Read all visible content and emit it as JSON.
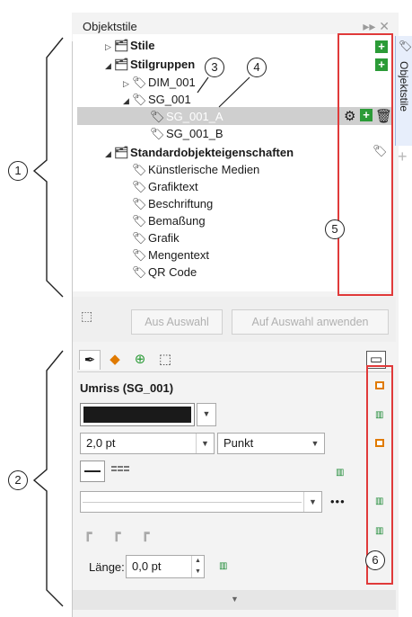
{
  "docker": {
    "title": "Objektstile",
    "controls": "▸▸ ✕",
    "side_tab_label": "Objektstile"
  },
  "tree": {
    "items": [
      {
        "label": "Stile",
        "icon": "styles-folder-icon",
        "bold": true,
        "expander": "▷"
      },
      {
        "label": "Stilgruppen",
        "icon": "style-groups-icon",
        "bold": true,
        "expander": "◢"
      },
      {
        "label": "DIM_001",
        "icon": "style-set-icon",
        "bold": false,
        "expander": "▷"
      },
      {
        "label": "SG_001",
        "icon": "style-set-icon",
        "bold": false,
        "expander": "◢"
      },
      {
        "label": "SG_001_A",
        "icon": "style-set-icon",
        "bold": false,
        "expander": "",
        "selected": true
      },
      {
        "label": "SG_001_B",
        "icon": "style-set-icon",
        "bold": false,
        "expander": ""
      },
      {
        "label": "Standardobjekteigenschaften",
        "icon": "default-properties-icon",
        "bold": true,
        "expander": "◢"
      },
      {
        "label": "Künstlerische Medien",
        "icon": "style-set-icon",
        "bold": false,
        "expander": ""
      },
      {
        "label": "Grafiktext",
        "icon": "style-set-icon",
        "bold": false,
        "expander": ""
      },
      {
        "label": "Beschriftung",
        "icon": "style-set-icon",
        "bold": false,
        "expander": ""
      },
      {
        "label": "Bemaßung",
        "icon": "style-set-icon",
        "bold": false,
        "expander": ""
      },
      {
        "label": "Grafik",
        "icon": "style-set-icon",
        "bold": false,
        "expander": ""
      },
      {
        "label": "Mengentext",
        "icon": "style-set-icon",
        "bold": false,
        "expander": ""
      },
      {
        "label": "QR Code",
        "icon": "style-set-icon",
        "bold": false,
        "expander": ""
      }
    ]
  },
  "toolbar": {
    "from_selection": "Aus Auswahl",
    "apply_to_selection": "Auf Auswahl anwenden"
  },
  "properties": {
    "title": "Umriss (SG_001)",
    "width_value": "2,0 pt",
    "unit_value": "Punkt",
    "length_label": "Länge:",
    "length_value": "0,0 pt",
    "more": "•••",
    "outline_color": "#1a1a1a"
  },
  "callouts": {
    "c1": "1",
    "c2": "2",
    "c3": "3",
    "c4": "4",
    "c5": "5",
    "c6": "6"
  },
  "colors": {
    "highlight_red": "#e03a3a",
    "add_green": "#2b9b37",
    "inherit_orange": "#e07a00",
    "selection_gray": "#cfcfcf"
  }
}
